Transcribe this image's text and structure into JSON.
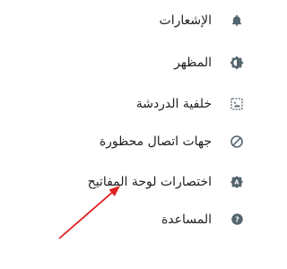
{
  "menu": {
    "items": [
      {
        "label": "الإشعارات",
        "icon": "bell-icon"
      },
      {
        "label": "المظهر",
        "icon": "brightness-icon"
      },
      {
        "label": "خلفية الدردشة",
        "icon": "wallpaper-icon"
      },
      {
        "label": "جهات اتصال محظورة",
        "icon": "block-icon"
      },
      {
        "label": "اختصارات لوحة المفاتيح",
        "icon": "keyboard-shortcuts-icon"
      },
      {
        "label": "المساعدة",
        "icon": "help-icon"
      }
    ]
  },
  "colors": {
    "icon": "#54656f",
    "text": "#1f1f1f",
    "arrow": "#e02020"
  }
}
